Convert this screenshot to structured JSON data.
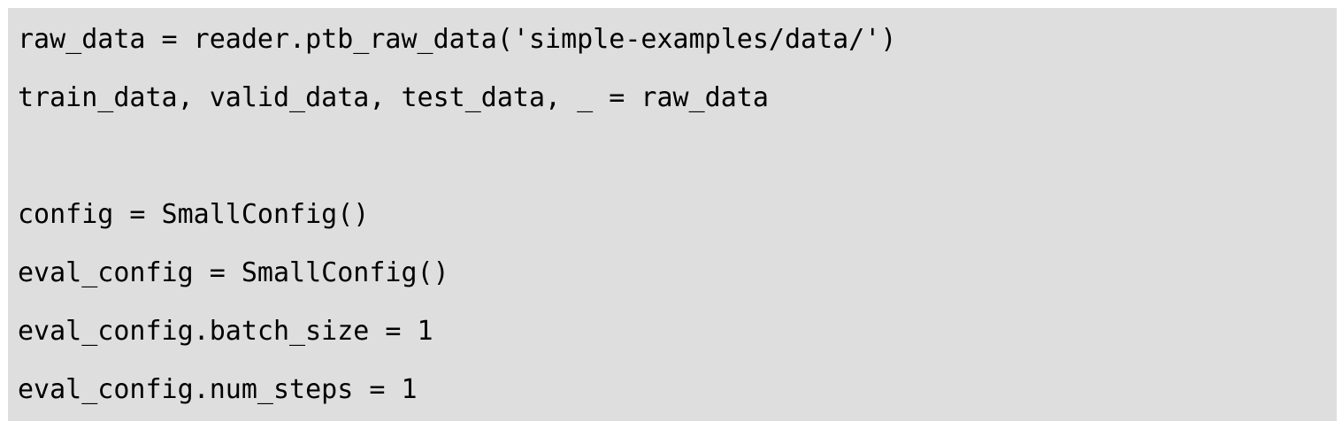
{
  "code": {
    "lines": [
      "raw_data = reader.ptb_raw_data('simple-examples/data/')",
      "train_data, valid_data, test_data, _ = raw_data",
      "",
      "config = SmallConfig()",
      "eval_config = SmallConfig()",
      "eval_config.batch_size = 1",
      "eval_config.num_steps = 1"
    ]
  }
}
